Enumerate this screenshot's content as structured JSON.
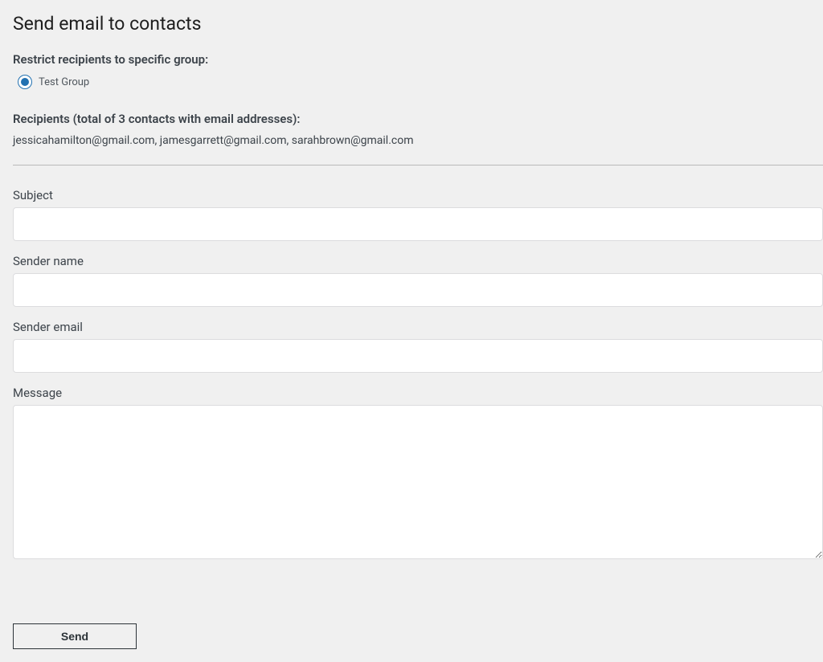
{
  "page": {
    "title": "Send email to contacts"
  },
  "restrict": {
    "label": "Restrict recipients to specific group:",
    "options": [
      {
        "label": "Test Group",
        "checked": true
      }
    ]
  },
  "recipients": {
    "label": "Recipients (total of 3 contacts with email addresses):",
    "list": "jessicahamilton@gmail.com, jamesgarrett@gmail.com, sarahbrown@gmail.com"
  },
  "form": {
    "subject": {
      "label": "Subject",
      "value": ""
    },
    "sender_name": {
      "label": "Sender name",
      "value": ""
    },
    "sender_email": {
      "label": "Sender email",
      "value": ""
    },
    "message": {
      "label": "Message",
      "value": ""
    },
    "send_button": "Send"
  }
}
